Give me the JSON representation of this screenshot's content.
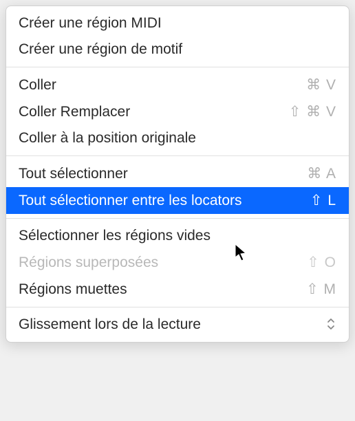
{
  "menu": {
    "items": [
      {
        "label": "Créer une région MIDI",
        "shortcut": "",
        "disabled": false,
        "highlighted": false,
        "separator": false,
        "submenu": false
      },
      {
        "label": "Créer une région de motif",
        "shortcut": "",
        "disabled": false,
        "highlighted": false,
        "separator": false,
        "submenu": false
      },
      {
        "separator": true
      },
      {
        "label": "Coller",
        "shortcut": "⌘ V",
        "disabled": false,
        "highlighted": false,
        "separator": false,
        "submenu": false
      },
      {
        "label": "Coller Remplacer",
        "shortcut": "⇧ ⌘ V",
        "disabled": false,
        "highlighted": false,
        "separator": false,
        "submenu": false
      },
      {
        "label": "Coller à la position originale",
        "shortcut": "",
        "disabled": false,
        "highlighted": false,
        "separator": false,
        "submenu": false
      },
      {
        "separator": true
      },
      {
        "label": "Tout sélectionner",
        "shortcut": "⌘ A",
        "disabled": false,
        "highlighted": false,
        "separator": false,
        "submenu": false
      },
      {
        "label": "Tout sélectionner entre les locators",
        "shortcut": "⇧ L",
        "disabled": false,
        "highlighted": true,
        "separator": false,
        "submenu": false
      },
      {
        "separator": true
      },
      {
        "label": "Sélectionner les régions vides",
        "shortcut": "",
        "disabled": false,
        "highlighted": false,
        "separator": false,
        "submenu": false
      },
      {
        "label": "Régions superposées",
        "shortcut": "⇧ O",
        "disabled": true,
        "highlighted": false,
        "separator": false,
        "submenu": false
      },
      {
        "label": "Régions muettes",
        "shortcut": "⇧ M",
        "disabled": false,
        "highlighted": false,
        "separator": false,
        "submenu": false
      },
      {
        "separator": true
      },
      {
        "label": "Glissement lors de la lecture",
        "shortcut": "",
        "disabled": false,
        "highlighted": false,
        "separator": false,
        "submenu": true
      }
    ]
  }
}
